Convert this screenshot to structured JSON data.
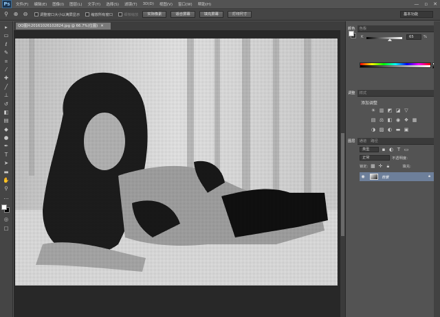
{
  "app": {
    "logo": "Ps"
  },
  "menu": [
    "文件(F)",
    "编辑(E)",
    "图像(I)",
    "图层(L)",
    "文字(Y)",
    "选择(S)",
    "滤镜(T)",
    "3D(D)",
    "视图(V)",
    "窗口(W)",
    "帮助(H)"
  ],
  "window_controls": [
    "—",
    "▫",
    "✕"
  ],
  "options": {
    "check1_label": "调整窗口大小以满屏显示",
    "check2_label": "缩放所有窗口",
    "check3_label": "细微缩放",
    "btn_actual": "实际像素",
    "btn_fit": "适合屏幕",
    "btn_fill": "填充屏幕",
    "btn_print": "打印尺寸",
    "workspace": "基本功能"
  },
  "document": {
    "tab_title": "QQ图片20161026102824.jpg @ 66.7%(位图)",
    "close": "✕"
  },
  "panels": {
    "color_tabs": [
      "颜色",
      "色板"
    ],
    "color_slider_label": "K",
    "color_value": "65",
    "color_unit": "%",
    "adjust_tabs": [
      "调整",
      "样式"
    ],
    "adjust_title": "添加调整",
    "layers_tabs": [
      "图层",
      "通道",
      "路径"
    ],
    "layer_filter": "类型",
    "blend_mode": "正常",
    "opacity_label": "不透明度:",
    "lock_label": "锁定:",
    "fill_label": "填充:",
    "layer_name": "背景"
  },
  "colors": {
    "accent": "#6d7f9a",
    "fg": "#ffffff",
    "bg": "#000000"
  }
}
